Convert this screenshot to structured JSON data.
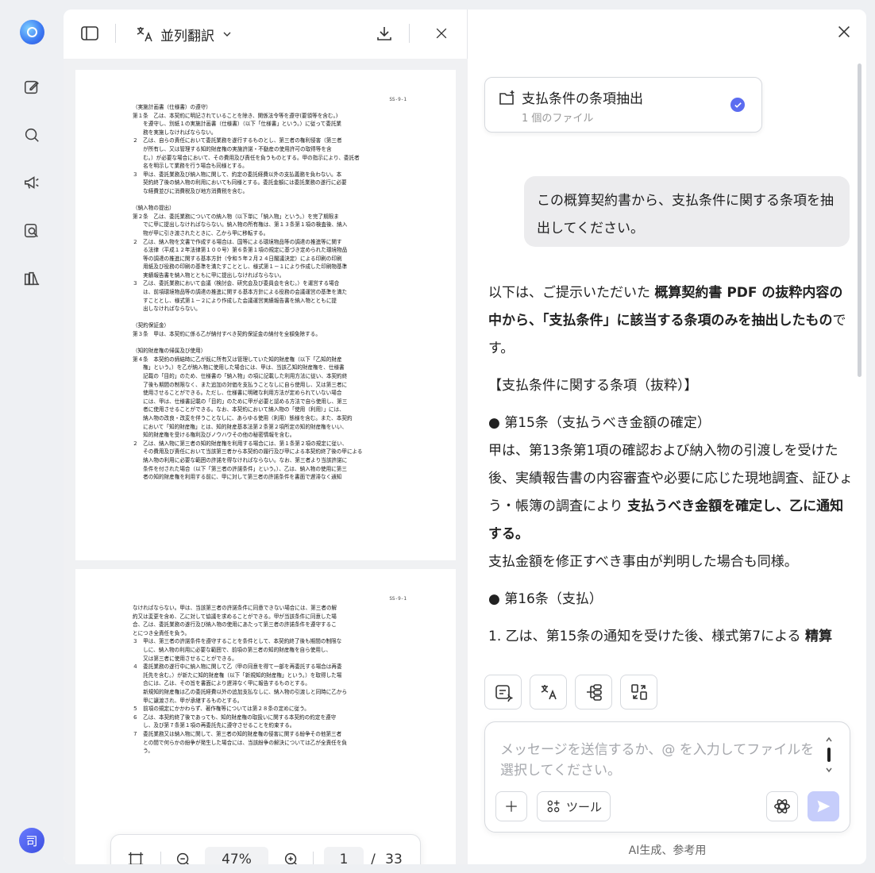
{
  "rail": {
    "items": [
      "compose-icon",
      "search-icon",
      "megaphone-icon",
      "doc-search-icon",
      "books-icon"
    ],
    "avatar_text": "司"
  },
  "pdf": {
    "mode_label": "並列翻訳",
    "page1_number": "SS-9-1",
    "page2_number": "SS-9-1",
    "page1_text": "（実施計画書（仕様書）の遵守）\n第１条　乙は、本契約に明記されていることを除き、関係法令等を遵守(要領等を含む。)\n　　を遵守し、別紙１の実施計画書（仕様書）（以下「仕様書」という。）に従って委託業\n　　務を実施しなければならない。\n２　乙は、自らの責任において委託業務を遂行するものとし、第三者の権利侵害（第三者\n　　が所有し、又は管理する知的財産権の実施許諾・不動産の使用許可の取得等を含\n　　む。）が必要な場合において、その費用及び責任を負うものとする。甲の指示により、委託者\n　　名を明示して業務を行う場合も同様とする。\n３　甲は、委託業務及び納入物に関して、約定の委託経費以外の支払義務を負わない。本\n　　契約終了後の納入物の利用においても同様とする。委託金額には委託業務の遂行に必要\n　　な経費並びに消費税及び地方消費税を含む。\n\n（納入物の提出）\n第２条　乙は、委託業務についての納入物（以下単に「納入物」という。）を完了期限ま\n　　でに甲に提出しなければならない。納入物の所有権は、第１３条第１項の検査後、納入\n　　物が甲に引き渡されたときに、乙から甲に移転する。\n２　乙は、納入物を文書で作成する場合は、国等による環境物品等の調達の推進等に関す\n　　る法律（平成１２年法律第１００号）第６条第１項の規定に基づき定められた環境物品\n　　等の調達の推進に関する基本方針（令和５年２月２４日閣議決定）による印刷の印刷\n　　用紙及び役務の印刷の基準を満たすこととし、様式第１－１により作成した印刷物基準\n　　実績報告書を納入物とともに甲に提出しなければならない。\n３　乙は、委託業務において会議（検討会、研究会及び委員会を含む。）を運営する場合\n　　は、前項環境物品等の調達の推進に関する基本方針による役務の会議運営の基準を満た\n　　すこととし、様式第１－２により作成した会議運営実績報告書を納入物とともに提\n　　出しなければならない。\n\n（契約保証金）\n第３条　甲は、本契約に係る乙が納付すべき契約保証金の納付を全額免除する。\n\n（知的財産権の帰属及び使用）\n第４条　本契約の締結時に乙が既に所有又は管理していた知的財産権（以下「乙知的財産\n　　権」という。）を乙が納入物に使用した場合には、甲は、当該乙知的財産権を、仕様書\n　　記載の「目的」のため、仕様書の「納入物」の項に記載した利用方法に従い、本契約終\n　　了後も期間の制限なく、また追加の対価を支払うことなしに自ら使用し、又は第三者に\n　　使用させることができる。ただし、仕様書に明確な利用方法が定められていない場合\n　　には、甲は、仕様書記載の「目的」のために甲が必要と認める方法で自ら使用し、第三\n　　者に使用させることができる。なお、本契約において納入物の「使用（利用）」には、\n　　納入物の改良・改変を伴うことなしに、あらゆる使用（利用）態様を含む。また、本契約\n　　において「知的財産権」とは、知的財産基本法第２条第２項所定の知的財産権をいい、\n　　知的財産権を受ける権利及びノウハウその他の秘密情報を含む。\n２　乙は、納入物に第三者の知的財産権を利用する場合には、第１条第２項の規定に従い、\n　　その費用及び責任において当該第三者から本契約の履行及び甲による本契約終了後の甲による\n　　納入物の利用に必要な範囲の許諾を得なければならない。なお、第三者より当該許諾に\n　　条件を付された場合（以下「第三者の許諾条件」という。）、乙は、納入物の使用に第三\n　　者の知的財産権を利用する前に、甲に対して第三者の許諾条件を書面で遅滞なく通知",
    "page2_text": "なければならない。甲は、当該第三者の許諾条件に同意できない場合には、第三者の解\n約又は変更を含め、乙に対して協議を求めることができる。甲が当該条件に同意した場\n合、乙は、委託業務の遂行及び納入物の使用にあたって第三者の許諾条件を遵守するこ\nとにつき全責任を負う。\n３　甲は、第三者の許諾条件を遵守することを条件として、本契約終了後も期間の制限な\n　　しに、納入物の利用に必要な範囲で、前項の第三者の知的財産権を自ら使用し、\n　　又は第三者に使用させることができる。\n４　委託業務の遂行中に納入物に関して乙（甲の同意を得て一部を再委託する場合は再委\n　　託先を含む。）が新たに知的財産権（以下「新規知的財産権」という。）を取得した場\n　　合には、乙は、その旨を書面により遅滞なく甲に報告するものとする。\n　　新規知的財産権は乙の委託経費以外の追加支払なしに、納入物の引渡しと同時に乙から\n　　甲に譲渡され、甲が承継するものとする。\n５　前項の規定にかかわらず、著作権等については第２８条の定めに従う。\n６　乙は、本契約終了後であっても、知的財産権の取扱いに関する本契約の約定を遵守\n　　し、及び第７条第１項の再委託先に遵守させることを約束する。\n７　委託業務又は納入物に関して、第三者の知的財産権の侵害に関する紛争その他第三者\n　　との間で何らかの紛争が発生した場合には、当該紛争の解決については乙が全責任を負\n　　う。",
    "zoom": "47%",
    "page_current": "1",
    "page_sep": "/",
    "page_total": "33"
  },
  "chat": {
    "task_title": "支払条件の条項抽出",
    "task_sub": "1 個のファイル",
    "user_message": "この概算契約書から、支払条件に関する条項を抽出してください。",
    "answer": {
      "intro_a": "以下は、ご提示いただいた ",
      "intro_b": "概算契約書 PDF の抜粋内容の中から、「支払条件」に該当する条項のみを抽出したもの",
      "intro_c": "です。",
      "heading": "【支払条件に関する条項（抜粋）】",
      "c15_title": "● 第15条（支払うべき金額の確定）",
      "c15_a": "甲は、第13条第1項の確認および納入物の引渡しを受けた後、実績報告書の内容審査や必要に応じた現地調査、証ひょう・帳簿の調査により ",
      "c15_b": "支払うべき金額を確定し、乙に通知する。",
      "c15_c": "支払金額を修正すべき事由が判明した場合も同様。",
      "c16_title": "● 第16条（支払）",
      "c16_a": "1. 乙は、第15条の通知を受けた後、様式第7による ",
      "c16_b": "精算"
    },
    "placeholder": "メッセージを送信するか、@ を入力してファイルを選択してください。",
    "tools_label": "ツール",
    "footnote": "AI生成、参考用"
  }
}
